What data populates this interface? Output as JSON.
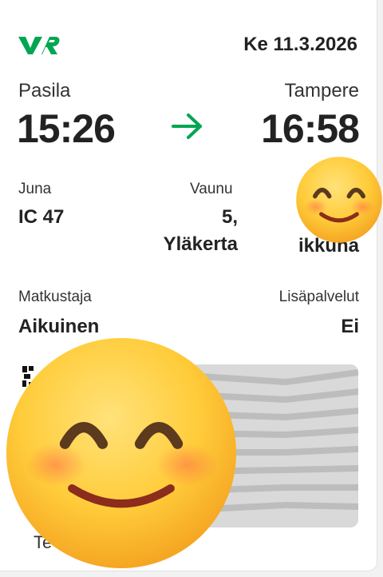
{
  "ticket": {
    "date": "Ke 11.3.2026",
    "from_station": "Pasila",
    "from_time": "15:26",
    "to_station": "Tampere",
    "to_time": "16:58",
    "train_label": "Juna",
    "train_value": "IC 47",
    "car_label": "Vaunu",
    "car_value_line1": "5,",
    "car_value_line2": "Yläkerta",
    "seat_value_partial": "ikkuna",
    "passenger_label": "Matkustaja",
    "passenger_value": "Aikuinen",
    "extras_label": "Lisäpalvelut",
    "extras_value": "Ei",
    "bottom_partial_text": "Te"
  },
  "icons": {
    "logo": "vr-logo",
    "arrow": "arrow-right-icon",
    "emoji": "smiling-face-emoji"
  },
  "colors": {
    "brand_green": "#00a651",
    "text": "#222222",
    "pattern_gray": "#d9d9d9"
  }
}
